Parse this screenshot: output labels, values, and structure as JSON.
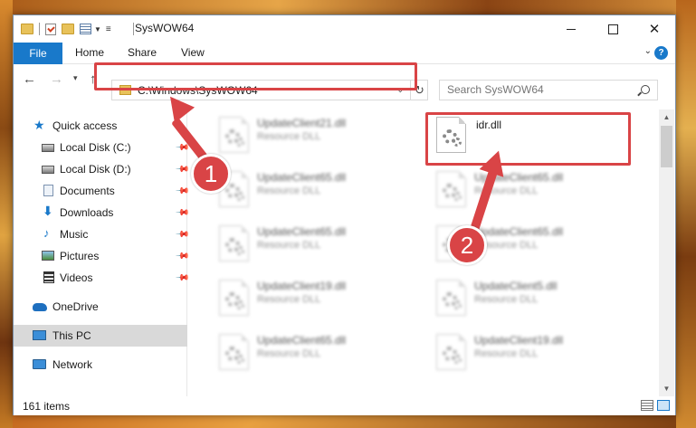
{
  "window": {
    "title": "SysWOW64"
  },
  "ribbon": {
    "tabs": [
      "File",
      "Home",
      "Share",
      "View"
    ]
  },
  "address": {
    "path": "C:\\Windows\\SysWOW64"
  },
  "search": {
    "placeholder": "Search SysWOW64"
  },
  "sidebar": {
    "items": [
      {
        "label": "Quick access"
      },
      {
        "label": "Local Disk (C:)"
      },
      {
        "label": "Local Disk (D:)"
      },
      {
        "label": "Documents"
      },
      {
        "label": "Downloads"
      },
      {
        "label": "Music"
      },
      {
        "label": "Pictures"
      },
      {
        "label": "Videos"
      },
      {
        "label": "OneDrive"
      },
      {
        "label": "This PC"
      },
      {
        "label": "Network"
      }
    ]
  },
  "files": {
    "left": [
      {
        "name": "UpdateClient21.dll",
        "type": "Resource DLL"
      },
      {
        "name": "UpdateClient65.dll",
        "type": "Resource DLL"
      },
      {
        "name": "UpdateClient65.dll",
        "type": "Resource DLL"
      },
      {
        "name": "UpdateClient19.dll",
        "type": "Resource DLL"
      },
      {
        "name": "UpdateClient65.dll",
        "type": "Resource DLL"
      }
    ],
    "right": [
      {
        "name": "idr.dll",
        "type": ""
      },
      {
        "name": "UpdateClient65.dll",
        "type": "Resource DLL"
      },
      {
        "name": "UpdateClient65.dll",
        "type": "Resource DLL"
      },
      {
        "name": "UpdateClient5.dll",
        "type": "Resource DLL"
      },
      {
        "name": "UpdateClient19.dll",
        "type": "Resource DLL"
      }
    ]
  },
  "status": {
    "count": "161 items"
  },
  "annotations": {
    "step1": "1",
    "step2": "2"
  },
  "colors": {
    "accent": "#1979ca",
    "highlight": "#d94446"
  }
}
